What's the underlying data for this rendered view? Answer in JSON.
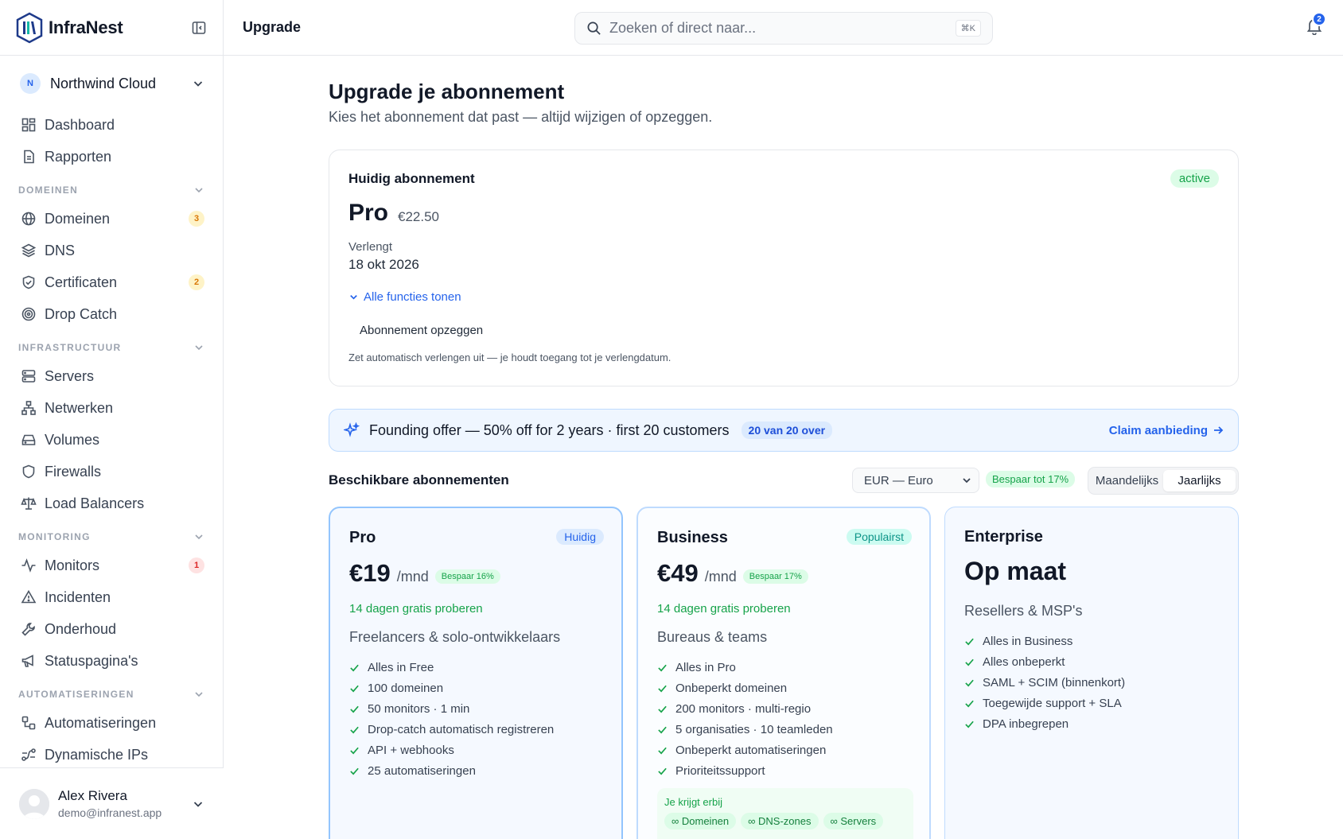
{
  "app": {
    "name": "InfraNest"
  },
  "org": {
    "initial": "N",
    "name": "Northwind Cloud"
  },
  "nav": {
    "top": [
      {
        "label": "Dashboard",
        "icon": "dashboard-icon"
      },
      {
        "label": "Rapporten",
        "icon": "report-icon"
      }
    ],
    "sections": [
      {
        "title": "DOMEINEN",
        "items": [
          {
            "label": "Domeinen",
            "icon": "globe-icon",
            "badge": "3"
          },
          {
            "label": "DNS",
            "icon": "layers-icon"
          },
          {
            "label": "Certificaten",
            "icon": "shield-check-icon",
            "badge": "2"
          },
          {
            "label": "Drop Catch",
            "icon": "target-icon"
          }
        ]
      },
      {
        "title": "INFRASTRUCTUUR",
        "items": [
          {
            "label": "Servers",
            "icon": "server-icon"
          },
          {
            "label": "Netwerken",
            "icon": "network-icon"
          },
          {
            "label": "Volumes",
            "icon": "drive-icon"
          },
          {
            "label": "Firewalls",
            "icon": "shield-icon"
          },
          {
            "label": "Load Balancers",
            "icon": "scale-icon"
          }
        ]
      },
      {
        "title": "MONITORING",
        "items": [
          {
            "label": "Monitors",
            "icon": "activity-icon",
            "badge": "1"
          },
          {
            "label": "Incidenten",
            "icon": "alert-icon"
          },
          {
            "label": "Onderhoud",
            "icon": "wrench-icon"
          },
          {
            "label": "Statuspagina's",
            "icon": "megaphone-icon"
          }
        ]
      },
      {
        "title": "AUTOMATISERINGEN",
        "items": [
          {
            "label": "Automatiseringen",
            "icon": "workflow-icon"
          },
          {
            "label": "Dynamische IPs",
            "icon": "dynamic-ip-icon"
          }
        ]
      }
    ]
  },
  "user": {
    "name": "Alex Rivera",
    "email": "demo@infranest.app"
  },
  "topbar": {
    "crumb": "Upgrade",
    "search_placeholder": "Zoeken of direct naar...",
    "shortcut": "⌘K",
    "notifications": "2"
  },
  "page": {
    "title": "Upgrade je abonnement",
    "subtitle": "Kies het abonnement dat past — altijd wijzigen of opzeggen."
  },
  "current": {
    "title": "Huidig abonnement",
    "status": "active",
    "plan": "Pro",
    "price": "€22.50",
    "renew_label": "Verlengt",
    "renew_date": "18 okt 2026",
    "show_features": "Alle functies tonen",
    "cancel": "Abonnement opzeggen",
    "cancel_note": "Zet automatisch verlengen uit — je houdt toegang tot je verlengdatum."
  },
  "offer": {
    "text": "Founding offer — 50% off for 2 years · first 20 customers",
    "badge": "20 van 20 over",
    "claim": "Claim aanbieding"
  },
  "plans_header": {
    "title": "Beschikbare abonnementen",
    "currency": "EUR — Euro",
    "save": "Bespaar tot 17%",
    "monthly": "Maandelijks",
    "yearly": "Jaarlijks"
  },
  "plans": [
    {
      "name": "Pro",
      "badge": "Huidig",
      "price": "€19",
      "unit": "/mnd",
      "save": "Bespaar 16%",
      "trial": "14 dagen gratis proberen",
      "audience": "Freelancers & solo-ontwikkelaars",
      "features": [
        "Alles in Free",
        "100 domeinen",
        "50 monitors · 1 min",
        "Drop-catch automatisch registreren",
        "API + webhooks",
        "25 automatiseringen"
      ]
    },
    {
      "name": "Business",
      "badge": "Populairst",
      "price": "€49",
      "unit": "/mnd",
      "save": "Bespaar 17%",
      "trial": "14 dagen gratis proberen",
      "audience": "Bureaus & teams",
      "features": [
        "Alles in Pro",
        "Onbeperkt domeinen",
        "200 monitors · multi-regio",
        "5 organisaties · 10 teamleden",
        "Onbeperkt automatiseringen",
        "Prioriteitssupport"
      ],
      "extras_title": "Je krijgt erbij",
      "extras": [
        "∞ Domeinen",
        "∞ DNS-zones",
        "∞ Servers"
      ]
    },
    {
      "name": "Enterprise",
      "price": "Op maat",
      "audience": "Resellers & MSP's",
      "features": [
        "Alles in Business",
        "Alles onbeperkt",
        "SAML + SCIM (binnenkort)",
        "Toegewijde support + SLA",
        "DPA inbegrepen"
      ]
    }
  ],
  "colors": {
    "accent": "#2563eb",
    "success": "#16a34a",
    "border": "#e5e7eb"
  }
}
